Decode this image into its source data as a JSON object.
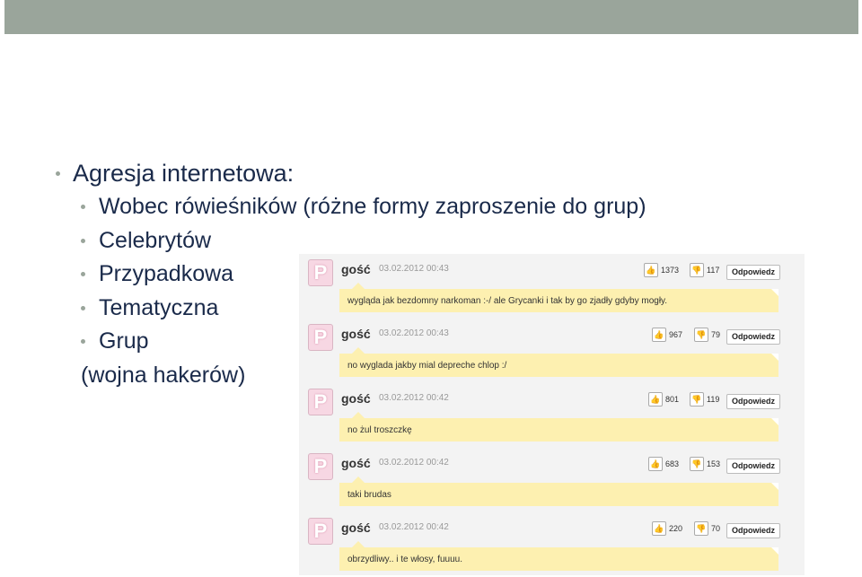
{
  "slide": {
    "title": "Agresja internetowa:",
    "items": [
      "Wobec rówieśników (różne formy zaproszenie do grup)",
      "Celebrytów",
      "Przypadkowa",
      "Tematyczna",
      "Grup"
    ],
    "note": "(wojna hakerów)"
  },
  "comments": [
    {
      "author": "gość",
      "date": "03.02.2012 00:43",
      "likes": "1373",
      "dislikes": "117",
      "reply": "Odpowiedz",
      "text": "wygląda jak bezdomny narkoman :-/ ale Grycanki i tak by go zjadły gdyby mogły."
    },
    {
      "author": "gość",
      "date": "03.02.2012 00:43",
      "likes": "967",
      "dislikes": "79",
      "reply": "Odpowiedz",
      "text": "no wyglada jakby mial depreche chlop :/"
    },
    {
      "author": "gość",
      "date": "03.02.2012 00:42",
      "likes": "801",
      "dislikes": "119",
      "reply": "Odpowiedz",
      "text": "no żul troszczkę"
    },
    {
      "author": "gość",
      "date": "03.02.2012 00:42",
      "likes": "683",
      "dislikes": "153",
      "reply": "Odpowiedz",
      "text": "taki brudas"
    },
    {
      "author": "gość",
      "date": "03.02.2012 00:42",
      "likes": "220",
      "dislikes": "70",
      "reply": "Odpowiedz",
      "text": "obrzydliwy.. i te włosy, fuuuu."
    }
  ],
  "icons": {
    "avatar": "p-avatar-icon",
    "like": "thumbs-up-icon",
    "dislike": "thumbs-down-icon"
  },
  "colors": {
    "accent": "#9aa59b",
    "text": "#1a2a4a",
    "bubble": "#fdf0b0"
  }
}
